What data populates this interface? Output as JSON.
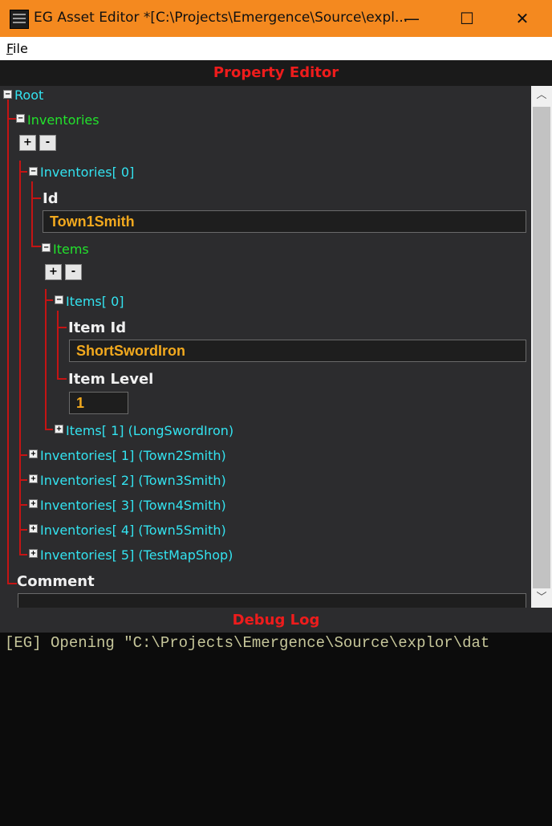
{
  "window": {
    "title": "EG Asset Editor *[C:\\Projects\\Emergence\\Source\\expl...",
    "minimize_glyph": "—",
    "maximize_glyph": "☐",
    "close_glyph": "✕"
  },
  "menu": {
    "file_accel": "F",
    "file_rest": "ile"
  },
  "property_editor": {
    "title": "Property Editor",
    "tree": {
      "root": "Root",
      "inventories": "Inventories",
      "add": "+",
      "remove": "-",
      "inv0": "Inventories[ 0]",
      "id_label": "Id",
      "id_value": "Town1Smith",
      "items": "Items",
      "items0": "Items[ 0]",
      "item_id_label": "Item Id",
      "item_id_value": "ShortSwordIron",
      "item_level_label": "Item Level",
      "item_level_value": "1",
      "items1": "Items[ 1] (LongSwordIron)",
      "inv1": "Inventories[ 1] (Town2Smith)",
      "inv2": "Inventories[ 2] (Town3Smith)",
      "inv3": "Inventories[ 3] (Town4Smith)",
      "inv4": "Inventories[ 4] (Town5Smith)",
      "inv5": "Inventories[ 5] (TestMapShop)",
      "comment_label": "Comment",
      "comment_value": ""
    },
    "expand_glyph": "+",
    "collapse_glyph": "−",
    "scroll_up_glyph": "︿",
    "scroll_down_glyph": "﹀"
  },
  "debug_log": {
    "title": "Debug Log",
    "lines": [
      "[EG] Opening \"C:\\Projects\\Emergence\\Source\\explor\\dat"
    ]
  }
}
